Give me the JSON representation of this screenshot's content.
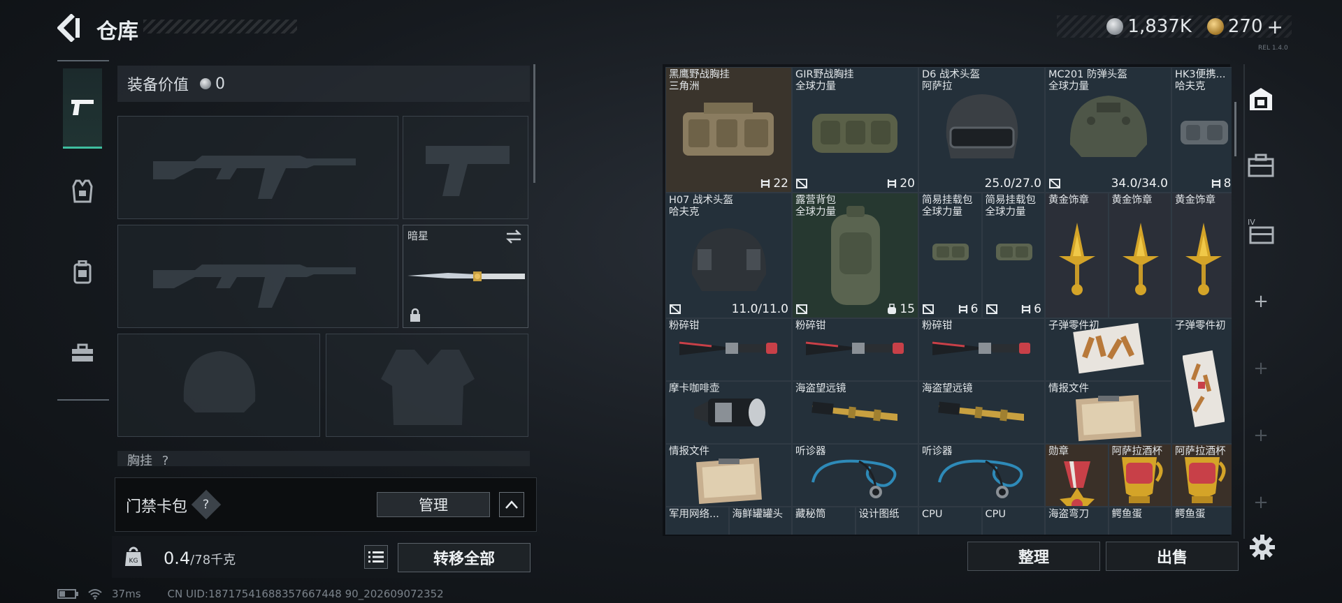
{
  "header": {
    "title": "仓库",
    "currency": [
      {
        "icon": "silver-coin-icon",
        "value": "1,837K"
      },
      {
        "icon": "gold-coin-icon",
        "value": "270"
      }
    ],
    "plus": "+",
    "version": "REL 1.4.0"
  },
  "tabs": [
    {
      "name": "weapon-tab-icon",
      "active": true
    },
    {
      "name": "armor-tab-icon"
    },
    {
      "name": "backpack-tab-icon"
    },
    {
      "name": "toolbox-tab-icon"
    }
  ],
  "loadout": {
    "equip_value_label": "装备价值",
    "equip_value": "0",
    "melee_name": "暗星",
    "chest_rig_label": "胸挂",
    "chest_rig_help": "?"
  },
  "access_card": {
    "label": "门禁卡包",
    "help": "?",
    "manage": "管理"
  },
  "weight": {
    "current": "0.4",
    "max": "/78千克"
  },
  "transfer_all": "转移全部",
  "status": {
    "ping": "37ms",
    "uid": "CN UID:18717541688357667448 90_202609072352"
  },
  "stash": {
    "items": [
      {
        "name": "黑鹰野战胸挂",
        "sub": "三角洲",
        "stat": "22",
        "stat_icon": "grid",
        "bg": "#3a342c",
        "art": "rig"
      },
      {
        "name": "GIR野战胸挂",
        "sub": "全球力量",
        "stat": "20",
        "stat_icon": "grid",
        "slot": true,
        "bg": "#24303a",
        "art": "rig2"
      },
      {
        "name": "D6 战术头盔",
        "sub": "阿萨拉",
        "stat": "25.0/27.0",
        "bg": "#24303a",
        "art": "helmet-d6"
      },
      {
        "name": "MC201 防弹头盔",
        "sub": "全球力量",
        "stat": "34.0/34.0",
        "slot": true,
        "bg": "#24303a",
        "art": "helmet-mc"
      },
      {
        "name": "HK3便携...",
        "sub": "哈夫克",
        "stat": "8",
        "stat_icon": "grid",
        "bg": "#24303a",
        "art": "rig-small"
      },
      {
        "name": "H07 战术头盔",
        "sub": "哈夫克",
        "stat": "11.0/11.0",
        "slot": true,
        "bg": "#24303a",
        "art": "helmet-h07"
      },
      {
        "name": "露营背包",
        "sub": "全球力量",
        "stat": "15",
        "stat_icon": "bag",
        "slot": true,
        "bg": "#263830",
        "art": "backpack"
      },
      {
        "name": "简易挂载包",
        "sub": "全球力量",
        "stat": "6",
        "stat_icon": "grid",
        "slot": true,
        "bg": "#24303a",
        "art": "pouch"
      },
      {
        "name": "简易挂载包",
        "sub": "全球力量",
        "stat": "6",
        "stat_icon": "grid",
        "slot": true,
        "bg": "#24303a",
        "art": "pouch"
      },
      {
        "name": "黄金饰章",
        "bg": "#2b2f38",
        "art": "medal-gold"
      },
      {
        "name": "黄金饰章",
        "bg": "#2b2f38",
        "art": "medal-gold"
      },
      {
        "name": "黄金饰章",
        "bg": "#2b2f38",
        "art": "medal-gold"
      },
      {
        "name": "粉碎钳",
        "bg": "#24303a",
        "art": "cutter"
      },
      {
        "name": "粉碎钳",
        "bg": "#24303a",
        "art": "cutter"
      },
      {
        "name": "粉碎钳",
        "bg": "#24303a",
        "art": "cutter"
      },
      {
        "name": "子弹零件初",
        "bg": "#24303a",
        "art": "ammo-parts"
      },
      {
        "name": "子弹零件初",
        "bg": "#24303a",
        "art": "ammo-parts-v"
      },
      {
        "name": "摩卡咖啡壶",
        "bg": "#24303a",
        "art": "mokapot"
      },
      {
        "name": "海盗望远镜",
        "bg": "#24303a",
        "art": "telescope"
      },
      {
        "name": "海盗望远镜",
        "bg": "#24303a",
        "art": "telescope"
      },
      {
        "name": "情报文件",
        "bg": "#24303a",
        "art": "clipboard"
      },
      {
        "name": "情报文件",
        "bg": "#24303a",
        "art": "clipboard"
      },
      {
        "name": "听诊器",
        "bg": "#24303a",
        "art": "stethoscope"
      },
      {
        "name": "听诊器",
        "bg": "#24303a",
        "art": "stethoscope"
      },
      {
        "name": "勋章",
        "bg": "#3a3028",
        "art": "medal-red"
      },
      {
        "name": "阿萨拉酒杯",
        "bg": "#3a3028",
        "art": "cup"
      },
      {
        "name": "阿萨拉酒杯",
        "bg": "#3a3028",
        "art": "cup"
      },
      {
        "name": "军用网络...",
        "bg": "#24303a",
        "art": "none"
      },
      {
        "name": "海鲜罐罐头",
        "bg": "#24303a",
        "art": "none"
      },
      {
        "name": "藏秘筒",
        "bg": "#24303a",
        "art": "none"
      },
      {
        "name": "设计图纸",
        "bg": "#24303a",
        "art": "none"
      },
      {
        "name": "CPU",
        "bg": "#24303a",
        "art": "none"
      },
      {
        "name": "CPU",
        "bg": "#24303a",
        "art": "none"
      },
      {
        "name": "海盗弯刀",
        "bg": "#24303a",
        "art": "none"
      },
      {
        "name": "鳄鱼蛋",
        "bg": "#24303a",
        "art": "none"
      },
      {
        "name": "鳄鱼蛋",
        "bg": "#24303a",
        "art": "none"
      }
    ]
  },
  "side_nav": [
    "safe-box-icon",
    "case-icon",
    "iv-case-icon",
    "plus-icon",
    "plus-icon",
    "plus-icon",
    "plus-icon"
  ],
  "buttons": {
    "sort": "整理",
    "sell": "出售"
  }
}
